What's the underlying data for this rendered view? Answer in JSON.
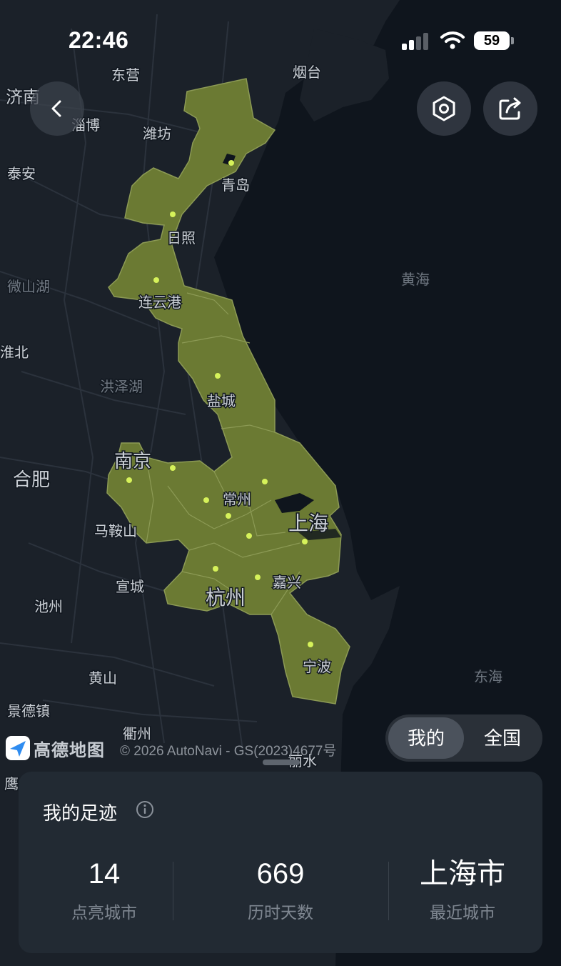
{
  "status_bar": {
    "time": "22:46",
    "battery": "59"
  },
  "map": {
    "labels": [
      {
        "id": "dongying",
        "text": "东营"
      },
      {
        "id": "yantai",
        "text": "烟台"
      },
      {
        "id": "jinan",
        "text": "济南"
      },
      {
        "id": "zibo",
        "text": "淄博"
      },
      {
        "id": "weifang",
        "text": "潍坊"
      },
      {
        "id": "taian",
        "text": "泰安"
      },
      {
        "id": "qingdao",
        "text": "青岛"
      },
      {
        "id": "rizhao",
        "text": "日照"
      },
      {
        "id": "weishanhu",
        "text": "微山湖"
      },
      {
        "id": "lianyungang",
        "text": "连云港"
      },
      {
        "id": "huanghai",
        "text": "黄海"
      },
      {
        "id": "huaibei",
        "text": "淮北"
      },
      {
        "id": "hongzehu",
        "text": "洪泽湖"
      },
      {
        "id": "yancheng",
        "text": "盐城"
      },
      {
        "id": "nanjing",
        "text": "南京"
      },
      {
        "id": "hefei",
        "text": "合肥"
      },
      {
        "id": "changzhou",
        "text": "常州"
      },
      {
        "id": "maanshan",
        "text": "马鞍山"
      },
      {
        "id": "shanghai",
        "text": "上海"
      },
      {
        "id": "xuancheng",
        "text": "宣城"
      },
      {
        "id": "jiaxing",
        "text": "嘉兴"
      },
      {
        "id": "hangzhou",
        "text": "杭州"
      },
      {
        "id": "chizhou",
        "text": "池州"
      },
      {
        "id": "ningbo",
        "text": "宁波"
      },
      {
        "id": "huangshan",
        "text": "黄山"
      },
      {
        "id": "donghai",
        "text": "东海"
      },
      {
        "id": "jingdezhen",
        "text": "景德镇"
      },
      {
        "id": "quzhou",
        "text": "衢州"
      },
      {
        "id": "lishui",
        "text": "丽水"
      },
      {
        "id": "yingtan",
        "text": "鹰"
      }
    ],
    "logo_text": "高德地图",
    "copyright": "© 2026 AutoNavi - GS(2023)4677号"
  },
  "toggle": {
    "mine": "我的",
    "national": "全国"
  },
  "panel": {
    "title": "我的足迹",
    "stats": [
      {
        "value": "14",
        "label": "点亮城市"
      },
      {
        "value": "669",
        "label": "历时天数"
      },
      {
        "value": "上海市",
        "label": "最近城市"
      }
    ]
  },
  "colors": {
    "highlight": "#6b7a33",
    "marker": "#d6f25a",
    "sea": "#0f151d",
    "land": "#1b2129"
  },
  "icons": [
    "back-icon",
    "settings-hexagon-icon",
    "share-icon",
    "info-icon",
    "amap-logo-icon",
    "signal-icon",
    "wifi-icon",
    "battery-icon"
  ]
}
